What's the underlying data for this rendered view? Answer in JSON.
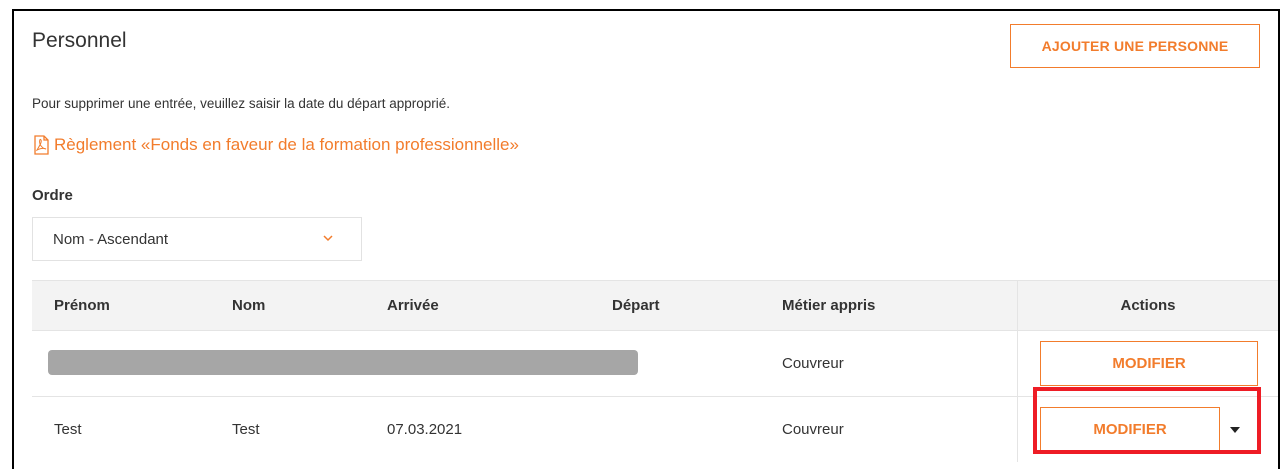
{
  "page": {
    "title": "Personnel",
    "add_button": "AJOUTER UNE PERSONNE",
    "notice": "Pour supprimer une entrée, veuillez saisir la date du départ approprié.",
    "reglement_link": "Règlement «Fonds en faveur de la formation professionnelle»",
    "reglement_icon": "pdf-icon"
  },
  "sort": {
    "label": "Ordre",
    "selected": "Nom - Ascendant",
    "icon": "chevron-down-icon"
  },
  "table": {
    "columns": [
      "Prénom",
      "Nom",
      "Arrivée",
      "Départ",
      "Métier appris",
      "Actions"
    ],
    "rows": [
      {
        "prenom": "",
        "nom": "",
        "arrivee": "",
        "depart": "",
        "metier": "Couvreur",
        "action": "MODIFIER",
        "redacted": true
      },
      {
        "prenom": "Test",
        "nom": "Test",
        "arrivee": "07.03.2021",
        "depart": "",
        "metier": "Couvreur",
        "action": "MODIFIER",
        "redacted": false
      }
    ]
  },
  "colors": {
    "accent": "#f27c2c",
    "highlight": "#ee1c25"
  }
}
